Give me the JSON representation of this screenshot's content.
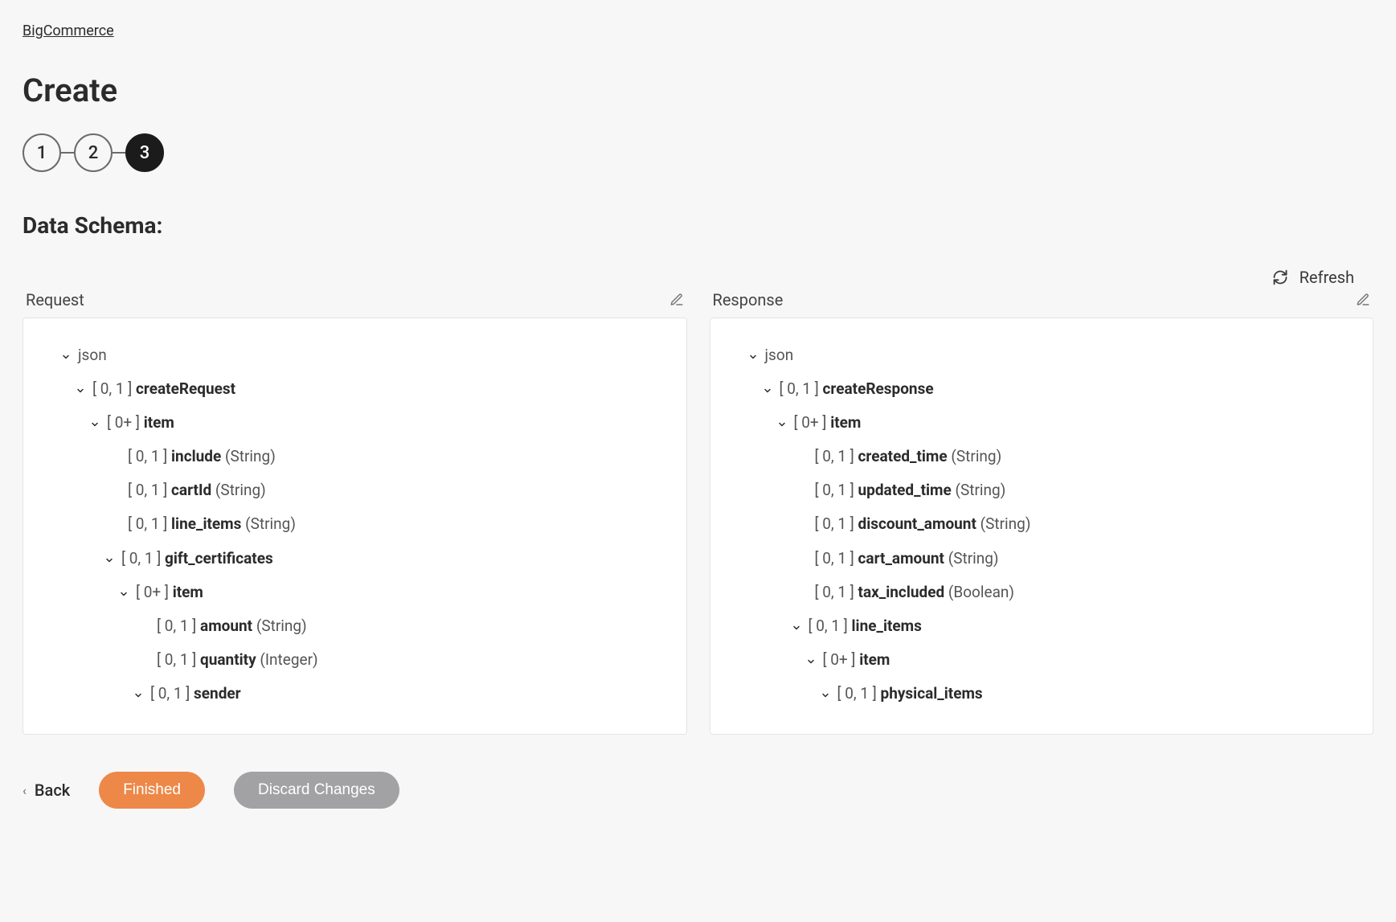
{
  "breadcrumb": "BigCommerce",
  "pageTitle": "Create",
  "stepper": {
    "steps": [
      "1",
      "2",
      "3"
    ],
    "active": 3
  },
  "sectionTitle": "Data Schema:",
  "refreshLabel": "Refresh",
  "request": {
    "title": "Request",
    "nodes": [
      {
        "caret": true,
        "indent": 0,
        "card": "",
        "name": "json",
        "type": ""
      },
      {
        "caret": true,
        "indent": 1,
        "card": "[ 0, 1 ]",
        "name": "createRequest",
        "type": ""
      },
      {
        "caret": true,
        "indent": 2,
        "card": "[ 0+ ]",
        "name": "item",
        "type": ""
      },
      {
        "caret": false,
        "indent": 3,
        "card": "[ 0, 1 ]",
        "name": "include",
        "type": "(String)"
      },
      {
        "caret": false,
        "indent": 3,
        "card": "[ 0, 1 ]",
        "name": "cartId",
        "type": "(String)"
      },
      {
        "caret": false,
        "indent": 3,
        "card": "[ 0, 1 ]",
        "name": "line_items",
        "type": "(String)"
      },
      {
        "caret": true,
        "indent": 3,
        "card": "[ 0, 1 ]",
        "name": "gift_certificates",
        "type": ""
      },
      {
        "caret": true,
        "indent": 4,
        "card": "[ 0+ ]",
        "name": "item",
        "type": ""
      },
      {
        "caret": false,
        "indent": 5,
        "card": "[ 0, 1 ]",
        "name": "amount",
        "type": "(String)"
      },
      {
        "caret": false,
        "indent": 5,
        "card": "[ 0, 1 ]",
        "name": "quantity",
        "type": "(Integer)"
      },
      {
        "caret": true,
        "indent": 5,
        "card": "[ 0, 1 ]",
        "name": "sender",
        "type": ""
      }
    ]
  },
  "response": {
    "title": "Response",
    "nodes": [
      {
        "caret": true,
        "indent": 0,
        "card": "",
        "name": "json",
        "type": ""
      },
      {
        "caret": true,
        "indent": 1,
        "card": "[ 0, 1 ]",
        "name": "createResponse",
        "type": ""
      },
      {
        "caret": true,
        "indent": 2,
        "card": "[ 0+ ]",
        "name": "item",
        "type": ""
      },
      {
        "caret": false,
        "indent": 3,
        "card": "[ 0, 1 ]",
        "name": "created_time",
        "type": "(String)"
      },
      {
        "caret": false,
        "indent": 3,
        "card": "[ 0, 1 ]",
        "name": "updated_time",
        "type": "(String)"
      },
      {
        "caret": false,
        "indent": 3,
        "card": "[ 0, 1 ]",
        "name": "discount_amount",
        "type": "(String)"
      },
      {
        "caret": false,
        "indent": 3,
        "card": "[ 0, 1 ]",
        "name": "cart_amount",
        "type": "(String)"
      },
      {
        "caret": false,
        "indent": 3,
        "card": "[ 0, 1 ]",
        "name": "tax_included",
        "type": "(Boolean)"
      },
      {
        "caret": true,
        "indent": 3,
        "card": "[ 0, 1 ]",
        "name": "line_items",
        "type": ""
      },
      {
        "caret": true,
        "indent": 4,
        "card": "[ 0+ ]",
        "name": "item",
        "type": ""
      },
      {
        "caret": true,
        "indent": 5,
        "card": "[ 0, 1 ]",
        "name": "physical_items",
        "type": ""
      }
    ]
  },
  "footer": {
    "back": "Back",
    "finished": "Finished",
    "discard": "Discard Changes"
  }
}
